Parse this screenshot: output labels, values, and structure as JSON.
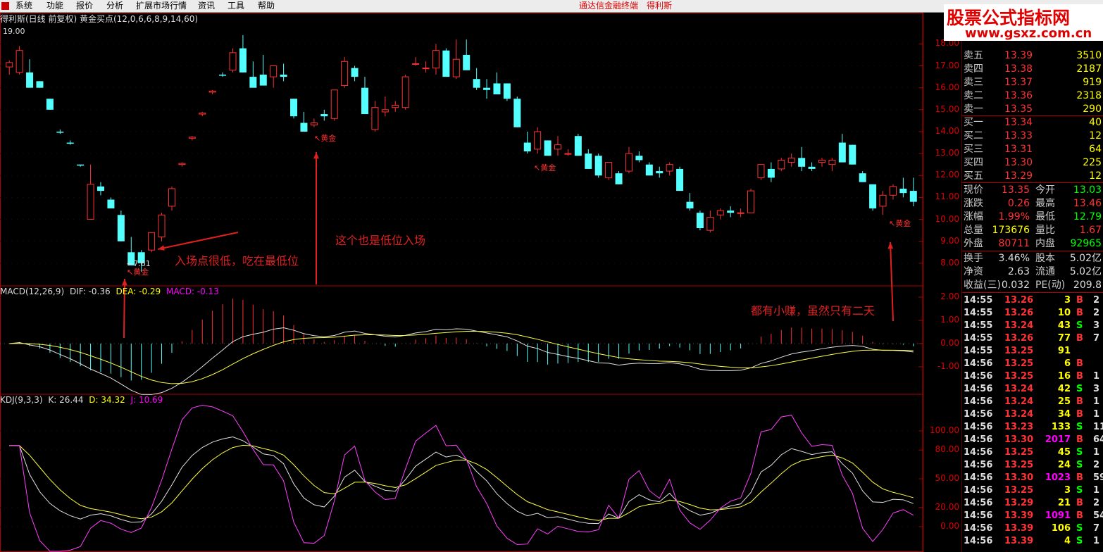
{
  "menu": {
    "items": [
      "系统",
      "功能",
      "报价",
      "分析",
      "扩展市场行情",
      "资讯",
      "工具",
      "帮助"
    ],
    "center_title": "通达信金融终端",
    "stock_name": "得利斯"
  },
  "banner": {
    "line1": "股票公式指标网",
    "line2": "www.gsxz.com.cn"
  },
  "main_panel": {
    "title": "得利斯(日线 前复权) 黄金买点(12,0,6,6,8,9,14,60)",
    "top_value": "19.00",
    "low_marker": "←7.61",
    "y_axis": [
      "18.00",
      "17.00",
      "16.00",
      "15.00",
      "14.00",
      "13.00",
      "12.00",
      "11.00",
      "10.00",
      "9.00",
      "8.00"
    ],
    "signal_label": "黄金",
    "annotations": {
      "a1": "入场点很低，吃在最低位",
      "a2": "这个也是低位入场",
      "a3": "都有小赚，虽然只有二天"
    }
  },
  "macd_panel": {
    "title_name": "MACD(12,26,9)",
    "dif": "DIF: -0.36",
    "dea": "DEA: -0.29",
    "macd": "MACD: -0.13",
    "y_axis": [
      "2.00",
      "1.00",
      "0.00",
      "-1.00"
    ]
  },
  "kdj_panel": {
    "title_name": "KDJ(9,3,3)",
    "k": "K: 26.44",
    "d": "D: 34.32",
    "j": "J: 10.69",
    "y_axis": [
      "100.00",
      "80.00",
      "50.00",
      "20.00",
      "0.00"
    ]
  },
  "quote": {
    "asks": [
      {
        "label": "卖五",
        "price": "13.39",
        "vol": "3510"
      },
      {
        "label": "卖四",
        "price": "13.38",
        "vol": "2187"
      },
      {
        "label": "卖三",
        "price": "13.37",
        "vol": "919"
      },
      {
        "label": "卖二",
        "price": "13.36",
        "vol": "2318"
      },
      {
        "label": "卖一",
        "price": "13.35",
        "vol": "290"
      }
    ],
    "bids": [
      {
        "label": "买一",
        "price": "13.34",
        "vol": "40"
      },
      {
        "label": "买二",
        "price": "13.33",
        "vol": "12"
      },
      {
        "label": "买三",
        "price": "13.31",
        "vol": "64"
      },
      {
        "label": "买四",
        "price": "13.30",
        "vol": "225"
      },
      {
        "label": "买五",
        "price": "13.29",
        "vol": "12"
      }
    ],
    "stats": [
      {
        "l1": "现价",
        "v1": "13.35",
        "l2": "今开",
        "v2": "13.03",
        "c1": "#f33",
        "c2": "#0f0"
      },
      {
        "l1": "涨跌",
        "v1": "0.26",
        "l2": "最高",
        "v2": "13.46",
        "c1": "#f33",
        "c2": "#f33"
      },
      {
        "l1": "涨幅",
        "v1": "1.99%",
        "l2": "最低",
        "v2": "12.79",
        "c1": "#f33",
        "c2": "#0f0"
      },
      {
        "l1": "总量",
        "v1": "173676",
        "l2": "量比",
        "v2": "1.67",
        "c1": "#ff0",
        "c2": "#f33"
      },
      {
        "l1": "外盘",
        "v1": "80711",
        "l2": "内盘",
        "v2": "92965",
        "c1": "#f33",
        "c2": "#0f0"
      },
      {
        "l1": "换手",
        "v1": "3.46%",
        "l2": "股本",
        "v2": "5.02亿",
        "c1": "#ddd",
        "c2": "#ddd"
      },
      {
        "l1": "净资",
        "v1": "2.63",
        "l2": "流通",
        "v2": "5.02亿",
        "c1": "#ddd",
        "c2": "#ddd"
      },
      {
        "l1": "收益(三)",
        "v1": "0.032",
        "l2": "PE(动)",
        "v2": "209.8",
        "c1": "#ddd",
        "c2": "#ddd"
      }
    ],
    "ticks": [
      {
        "t": "14:55",
        "p": "13.26",
        "v": "3",
        "s": "B",
        "x": "2"
      },
      {
        "t": "14:55",
        "p": "13.26",
        "v": "10",
        "s": "B",
        "x": "2"
      },
      {
        "t": "14:55",
        "p": "13.24",
        "v": "43",
        "s": "S",
        "x": "3"
      },
      {
        "t": "14:55",
        "p": "13.26",
        "v": "77",
        "s": "B",
        "x": "7"
      },
      {
        "t": "14:55",
        "p": "13.25",
        "v": "91",
        "s": "",
        "x": ""
      },
      {
        "t": "14:56",
        "p": "13.25",
        "v": "6",
        "s": "B",
        "x": ""
      },
      {
        "t": "14:56",
        "p": "13.25",
        "v": "16",
        "s": "B",
        "x": "1"
      },
      {
        "t": "14:56",
        "p": "13.24",
        "v": "42",
        "s": "S",
        "x": "3"
      },
      {
        "t": "14:56",
        "p": "13.24",
        "v": "25",
        "s": "B",
        "x": "1"
      },
      {
        "t": "14:56",
        "p": "13.24",
        "v": "34",
        "s": "B",
        "x": "1"
      },
      {
        "t": "14:56",
        "p": "13.23",
        "v": "133",
        "s": "S",
        "x": "11"
      },
      {
        "t": "14:56",
        "p": "13.30",
        "v": "2017",
        "s": "B",
        "x": "64"
      },
      {
        "t": "14:56",
        "p": "13.25",
        "v": "45",
        "s": "S",
        "x": "1"
      },
      {
        "t": "14:56",
        "p": "13.25",
        "v": "24",
        "s": "S",
        "x": "2"
      },
      {
        "t": "14:56",
        "p": "13.30",
        "v": "1023",
        "s": "B",
        "x": "59"
      },
      {
        "t": "14:56",
        "p": "13.25",
        "v": "3",
        "s": "S",
        "x": "1"
      },
      {
        "t": "14:56",
        "p": "13.29",
        "v": "21",
        "s": "B",
        "x": "2"
      },
      {
        "t": "14:56",
        "p": "13.39",
        "v": "1091",
        "s": "B",
        "x": "54"
      },
      {
        "t": "14:56",
        "p": "13.39",
        "v": "106",
        "s": "S",
        "x": "7"
      },
      {
        "t": "14:56",
        "p": "13.39",
        "v": "4",
        "s": "S",
        "x": "1"
      }
    ]
  },
  "chart_data": {
    "type": "candlestick",
    "series_ohlc": [
      [
        16.95,
        17.25,
        16.6,
        17.15
      ],
      [
        16.7,
        17.9,
        16.6,
        17.7
      ],
      [
        16.7,
        17.3,
        16.1,
        16.0
      ],
      [
        16.3,
        16.3,
        16.0,
        16.0
      ],
      [
        15.5,
        15.5,
        15.0,
        15.0
      ],
      [
        14.0,
        14.1,
        13.9,
        13.95
      ],
      [
        13.5,
        13.6,
        13.4,
        13.45
      ],
      [
        12.5,
        12.5,
        12.4,
        12.45
      ],
      [
        10.0,
        12.5,
        10.0,
        11.6
      ],
      [
        11.5,
        11.7,
        11.1,
        11.3
      ],
      [
        10.9,
        11.0,
        10.5,
        10.5
      ],
      [
        10.2,
        10.4,
        9.0,
        9.0
      ],
      [
        8.5,
        9.2,
        8.0,
        7.9
      ],
      [
        8.5,
        8.6,
        7.61,
        8.0
      ],
      [
        8.6,
        9.4,
        8.5,
        9.4
      ],
      [
        9.2,
        10.3,
        9.0,
        10.2
      ],
      [
        10.6,
        11.5,
        10.4,
        11.4
      ],
      [
        12.5,
        12.6,
        12.4,
        12.55
      ],
      [
        13.7,
        13.8,
        13.6,
        13.75
      ],
      [
        14.8,
        14.9,
        14.7,
        14.85
      ],
      [
        15.8,
        15.9,
        15.7,
        15.85
      ],
      [
        16.6,
        16.7,
        16.5,
        16.55
      ],
      [
        16.8,
        17.8,
        16.7,
        17.6
      ],
      [
        17.8,
        18.4,
        16.7,
        16.7
      ],
      [
        16.5,
        17.2,
        16.2,
        16.0
      ],
      [
        16.6,
        17.5,
        16.1,
        16.1
      ],
      [
        16.5,
        17.0,
        16.0,
        17.0
      ],
      [
        16.6,
        17.1,
        16.3,
        16.5
      ],
      [
        15.5,
        15.5,
        14.6,
        14.7
      ],
      [
        14.4,
        14.9,
        14.0,
        14.0
      ],
      [
        14.3,
        14.6,
        14.2,
        14.4
      ],
      [
        14.8,
        15.0,
        14.5,
        14.7
      ],
      [
        14.6,
        15.9,
        14.5,
        15.9
      ],
      [
        16.1,
        17.4,
        16.0,
        17.2
      ],
      [
        16.9,
        17.0,
        16.3,
        16.5
      ],
      [
        16.0,
        16.5,
        14.8,
        14.8
      ],
      [
        14.1,
        15.4,
        14.0,
        15.1
      ],
      [
        14.9,
        15.6,
        14.7,
        15.0
      ],
      [
        15.1,
        15.4,
        14.9,
        15.2
      ],
      [
        15.1,
        16.6,
        15.0,
        16.5
      ],
      [
        17.1,
        17.4,
        17.0,
        17.1
      ],
      [
        16.9,
        17.2,
        16.7,
        16.9
      ],
      [
        16.9,
        18.0,
        16.6,
        17.7
      ],
      [
        17.7,
        17.8,
        16.6,
        16.5
      ],
      [
        16.5,
        18.2,
        16.4,
        17.3
      ],
      [
        17.5,
        18.2,
        16.8,
        16.8
      ],
      [
        16.4,
        16.9,
        15.9,
        16.0
      ],
      [
        16.0,
        16.4,
        15.5,
        15.9
      ],
      [
        16.2,
        16.7,
        16.0,
        15.7
      ],
      [
        16.2,
        16.2,
        15.4,
        15.5
      ],
      [
        15.5,
        15.6,
        14.2,
        14.2
      ],
      [
        13.5,
        14.0,
        13.0,
        13.1
      ],
      [
        13.2,
        14.2,
        13.0,
        14.0
      ],
      [
        13.6,
        13.6,
        12.9,
        12.9
      ],
      [
        13.2,
        13.8,
        12.9,
        13.4
      ],
      [
        13.0,
        13.2,
        12.9,
        13.0
      ],
      [
        13.8,
        13.9,
        12.9,
        12.9
      ],
      [
        13.0,
        13.2,
        12.3,
        12.3
      ],
      [
        12.9,
        13.0,
        11.9,
        12.0
      ],
      [
        11.9,
        12.6,
        11.8,
        12.6
      ],
      [
        12.1,
        12.2,
        11.6,
        11.6
      ],
      [
        12.2,
        13.3,
        12.1,
        13.0
      ],
      [
        12.9,
        13.1,
        12.6,
        12.7
      ],
      [
        12.5,
        12.6,
        12.0,
        12.0
      ],
      [
        12.2,
        12.4,
        11.9,
        12.1
      ],
      [
        12.2,
        12.6,
        12.0,
        12.5
      ],
      [
        12.3,
        12.4,
        11.3,
        11.3
      ],
      [
        10.8,
        11.2,
        10.4,
        10.5
      ],
      [
        10.3,
        10.4,
        9.5,
        9.6
      ],
      [
        9.5,
        10.4,
        9.4,
        10.1
      ],
      [
        10.2,
        10.5,
        10.0,
        10.4
      ],
      [
        10.4,
        10.6,
        10.1,
        10.3
      ],
      [
        10.3,
        10.5,
        10.1,
        10.3
      ],
      [
        10.3,
        11.4,
        10.3,
        11.3
      ],
      [
        11.9,
        12.5,
        11.8,
        12.5
      ],
      [
        12.3,
        12.6,
        11.7,
        11.9
      ],
      [
        12.3,
        12.8,
        12.2,
        12.7
      ],
      [
        12.6,
        13.0,
        12.4,
        12.8
      ],
      [
        12.8,
        13.3,
        12.2,
        12.4
      ],
      [
        12.4,
        12.6,
        12.2,
        12.3
      ],
      [
        12.6,
        12.8,
        12.4,
        12.7
      ],
      [
        12.5,
        12.8,
        12.2,
        12.7
      ],
      [
        13.5,
        13.9,
        12.6,
        12.6
      ],
      [
        13.4,
        13.4,
        12.5,
        12.5
      ],
      [
        12.1,
        12.2,
        11.7,
        11.7
      ],
      [
        11.6,
        11.6,
        10.4,
        10.5
      ],
      [
        10.6,
        11.3,
        10.2,
        11.1
      ],
      [
        11.1,
        11.6,
        10.9,
        11.5
      ],
      [
        11.4,
        11.9,
        11.0,
        11.2
      ],
      [
        11.3,
        11.9,
        10.6,
        10.8
      ]
    ],
    "ylim": [
      7.0,
      19.2
    ]
  }
}
